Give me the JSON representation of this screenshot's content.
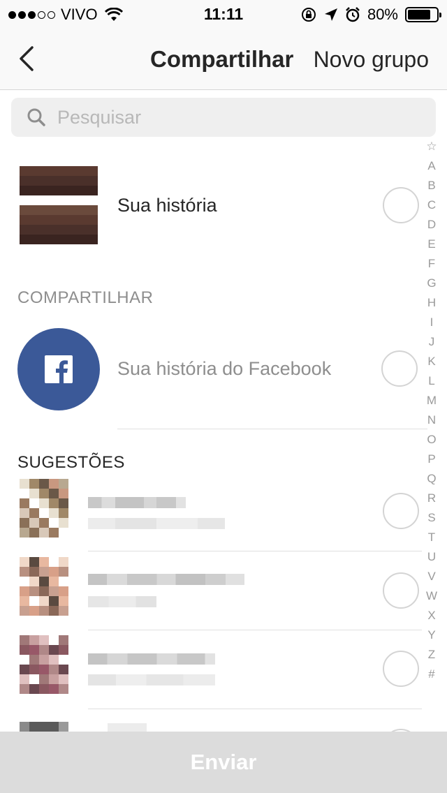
{
  "status_bar": {
    "carrier": "VIVO",
    "time": "11:11",
    "battery": "80%",
    "battery_level": 0.8,
    "icons": [
      "signal-dots-icon",
      "wifi-icon",
      "orientation-lock-icon",
      "location-arrow-icon",
      "alarm-clock-icon",
      "battery-icon"
    ]
  },
  "nav": {
    "title": "Compartilhar",
    "right_action": "Novo grupo",
    "back_icon": "chevron-left-icon"
  },
  "search": {
    "placeholder": "Pesquisar",
    "value": ""
  },
  "story_row": {
    "label": "Sua história",
    "selected": false
  },
  "share_section": {
    "header": "COMPARTILHAR",
    "facebook_label": "Sua história do Facebook",
    "facebook_icon": "facebook-icon",
    "selected": false
  },
  "suggestions_section": {
    "header": "SUGESTÕES",
    "items": [
      {
        "name": "",
        "subtitle": "",
        "selected": false
      },
      {
        "name": "",
        "subtitle": "",
        "selected": false
      },
      {
        "name": "",
        "subtitle": "",
        "selected": false
      }
    ]
  },
  "alpha_index": [
    "☆",
    "A",
    "B",
    "C",
    "D",
    "E",
    "F",
    "G",
    "H",
    "I",
    "J",
    "K",
    "L",
    "M",
    "N",
    "O",
    "P",
    "Q",
    "R",
    "S",
    "T",
    "U",
    "V",
    "W",
    "X",
    "Y",
    "Z",
    "#"
  ],
  "send_button": {
    "label": "Enviar",
    "enabled": false
  },
  "colors": {
    "facebook_blue": "#3b5998",
    "section_header_gray": "#8e8e8e",
    "send_disabled_bg": "#dcdcdc"
  }
}
